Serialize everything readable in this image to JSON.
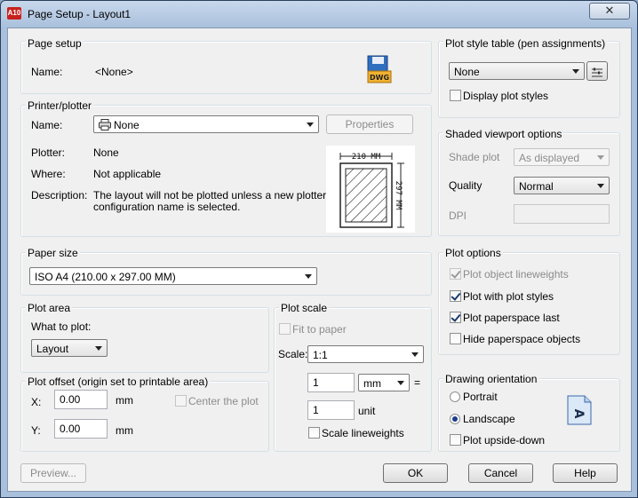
{
  "window": {
    "title": "Page Setup - Layout1",
    "app_icon_text": "A10",
    "close_label": "✕"
  },
  "page_setup": {
    "group_label": "Page setup",
    "name_label": "Name:",
    "name_value": "<None>",
    "dwg_icon_text": "DWG"
  },
  "printer": {
    "group_label": "Printer/plotter",
    "name_label": "Name:",
    "name_value": "None",
    "properties_label": "Properties",
    "plotter_label": "Plotter:",
    "plotter_value": "None",
    "where_label": "Where:",
    "where_value": "Not applicable",
    "description_label": "Description:",
    "description_line1": "The layout will not be plotted unless a new plotter",
    "description_line2": "configuration name is selected.",
    "paper_width_label": "210  MM",
    "paper_height_label": "297  MM"
  },
  "paper_size": {
    "group_label": "Paper size",
    "value": "ISO A4 (210.00 x 297.00 MM)"
  },
  "plot_area": {
    "group_label": "Plot area",
    "what_label": "What to plot:",
    "what_value": "Layout"
  },
  "plot_offset": {
    "group_label": "Plot offset (origin set to printable area)",
    "x_label": "X:",
    "x_value": "0.00",
    "x_unit": "mm",
    "y_label": "Y:",
    "y_value": "0.00",
    "y_unit": "mm",
    "center_label": "Center the plot"
  },
  "plot_scale": {
    "group_label": "Plot scale",
    "fit_label": "Fit to paper",
    "scale_label": "Scale:",
    "scale_value": "1:1",
    "top_value": "1",
    "unit_value": "mm",
    "equals": "=",
    "bottom_value": "1",
    "bottom_unit": "unit",
    "lineweights_label": "Scale lineweights"
  },
  "plot_style": {
    "group_label": "Plot style table (pen assignments)",
    "value": "None",
    "display_label": "Display plot styles"
  },
  "shaded": {
    "group_label": "Shaded viewport options",
    "shade_label": "Shade plot",
    "shade_value": "As displayed",
    "quality_label": "Quality",
    "quality_value": "Normal",
    "dpi_label": "DPI",
    "dpi_value": ""
  },
  "plot_options": {
    "group_label": "Plot options",
    "object_lineweights": "Plot object lineweights",
    "with_plot_styles": "Plot with plot styles",
    "paperspace_last": "Plot paperspace last",
    "hide_paperspace": "Hide paperspace objects"
  },
  "orientation": {
    "group_label": "Drawing orientation",
    "portrait": "Portrait",
    "landscape": "Landscape",
    "upside_down": "Plot upside-down",
    "icon_letter": "A"
  },
  "footer": {
    "preview": "Preview...",
    "ok": "OK",
    "cancel": "Cancel",
    "help": "Help"
  }
}
